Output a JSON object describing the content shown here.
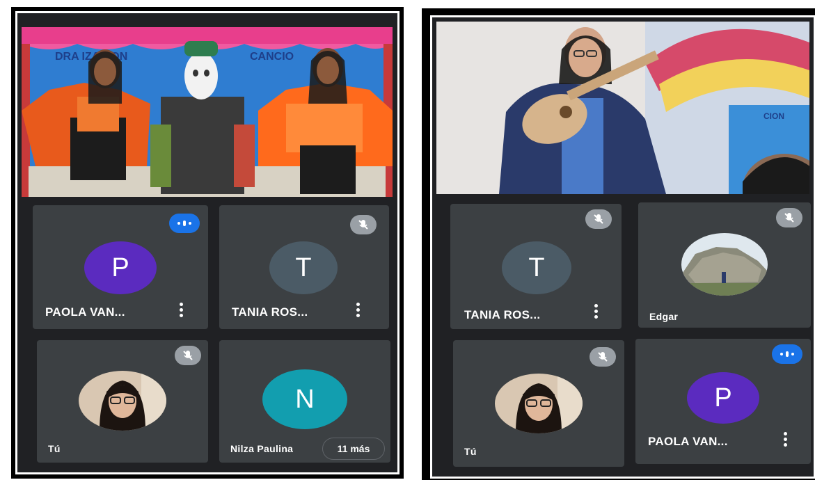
{
  "left": {
    "tiles": [
      {
        "name": "PAOLA VAN...",
        "initial": "P",
        "color": "#5b2bbf",
        "status": "speaking"
      },
      {
        "name": "TANIA ROS...",
        "initial": "T",
        "color": "#4b5b66",
        "status": "muted"
      },
      {
        "name": "Tú",
        "status": "muted"
      },
      {
        "name": "Nilza Paulina",
        "initial": "N",
        "color": "#129eaf",
        "status": "none"
      }
    ],
    "more_badge": "11 más"
  },
  "right": {
    "tiles": [
      {
        "name": "TANIA ROS...",
        "initial": "T",
        "color": "#4b5b66",
        "status": "muted"
      },
      {
        "name": "Edgar",
        "status": "muted"
      },
      {
        "name": "Tú",
        "status": "muted"
      },
      {
        "name": "PAOLA VAN...",
        "initial": "P",
        "color": "#5b2bbf",
        "status": "speaking"
      }
    ]
  },
  "icons": {
    "muted": "mic-off-icon",
    "speaking": "speaking-indicator-icon",
    "more": "more-vert-icon"
  }
}
